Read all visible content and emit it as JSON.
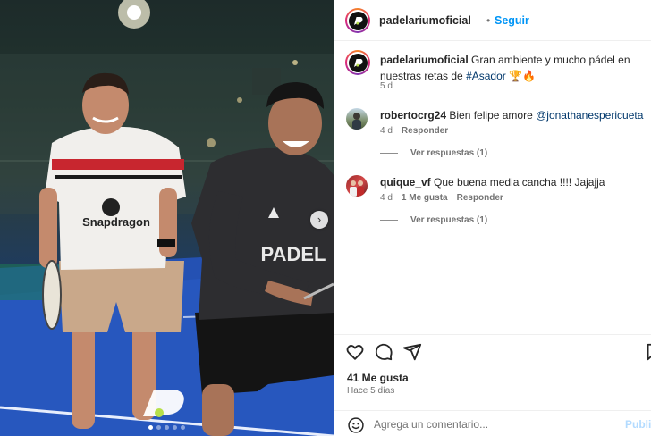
{
  "post": {
    "username": "padelariumoficial",
    "follow_label": "Seguir",
    "separator": "•",
    "caption_text": "Gran ambiente y mucho pádel en nuestras retas de",
    "caption_hashtag": "#Asador",
    "caption_emoji": "🏆🔥",
    "caption_age": "5 d",
    "shirt_text_left": "Snapdragon",
    "shirt_text_right": "PADEL",
    "likes": "41 Me gusta",
    "posted": "Hace 5 días",
    "comment_placeholder": "Agrega un comentario...",
    "publish_label": "Publicar",
    "more_icon": "more-options-icon"
  },
  "comments": [
    {
      "username": "robertocrg24",
      "text": "Bien felipe amore",
      "mention": "@jonathanespericueta",
      "age": "4 d",
      "likes": "",
      "reply_label": "Responder",
      "view_replies": "Ver respuestas (1)"
    },
    {
      "username": "quique_vf",
      "text": "Que buena media cancha !!!! Jajajja",
      "mention": "",
      "age": "4 d",
      "likes": "1 Me gusta",
      "reply_label": "Responder",
      "view_replies": "Ver respuestas (1)"
    }
  ],
  "carousel": {
    "slides": 5,
    "active_index": 0
  },
  "colors": {
    "accent": "#0095f6",
    "text": "#262626",
    "muted": "#737373",
    "hashtag": "#00376b"
  },
  "icons": [
    "heart-icon",
    "comment-icon",
    "share-icon",
    "bookmark-icon",
    "emoji-icon",
    "chevron-right-icon"
  ]
}
